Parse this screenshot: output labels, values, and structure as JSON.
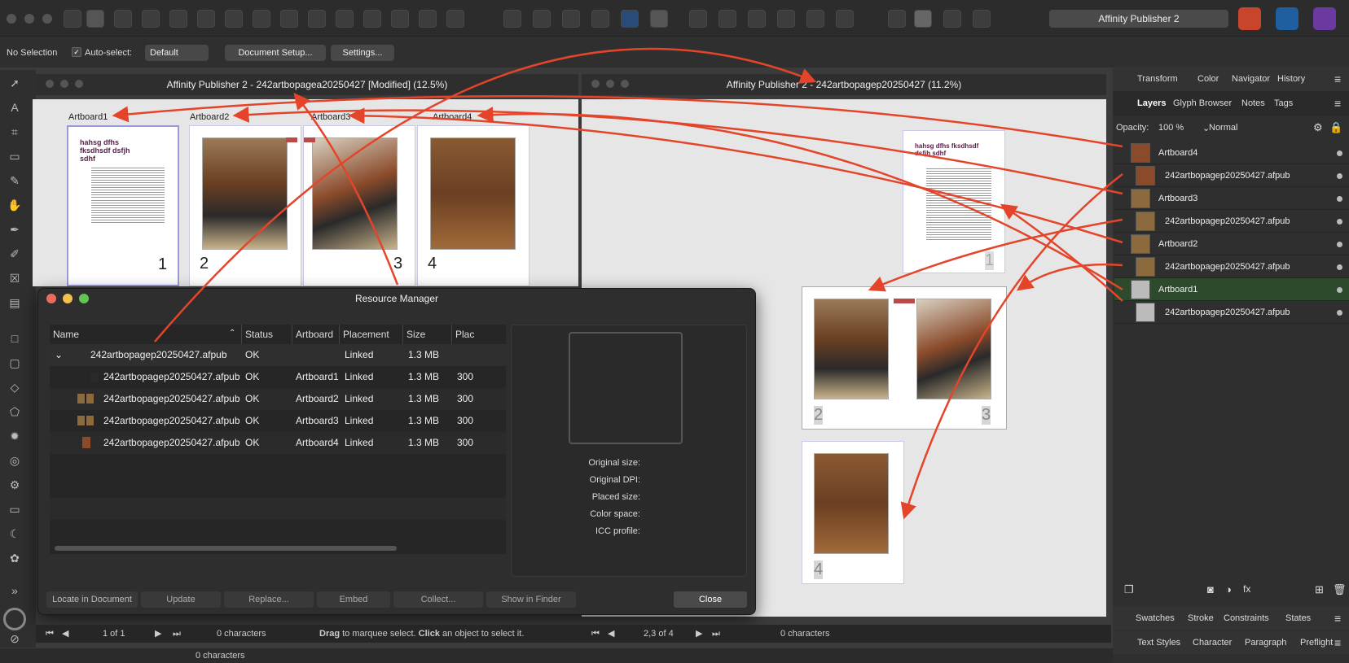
{
  "app": {
    "name": "Affinity Publisher 2"
  },
  "context": {
    "selection": "No Selection",
    "autoselect_label": "Auto-select:",
    "autoselect_value": "Default",
    "doc_setup": "Document Setup...",
    "settings": "Settings..."
  },
  "windows": {
    "left_title": "Affinity Publisher 2 - 242artbopagea20250427 [Modified] (12.5%)",
    "right_title": "Affinity Publisher 2 - 242artbopagep20250427 (11.2%)"
  },
  "artboards": [
    "Artboard1",
    "Artboard2",
    "Artboard3",
    "Artboard4"
  ],
  "page_text": "hahsg dfhs fksdhsdf dsfjh sdhf",
  "page_numbers": [
    "1",
    "2",
    "3",
    "4"
  ],
  "resource_manager": {
    "title": "Resource Manager",
    "columns": [
      "Name",
      "Status",
      "Artboard",
      "Placement",
      "Size",
      "Plac"
    ],
    "rows": [
      {
        "name": "242artbopagep20250427.afpub",
        "status": "OK",
        "artboard": "",
        "placement": "Linked",
        "size": "1.3 MB",
        "plac": ""
      },
      {
        "name": "242artbopagep20250427.afpub",
        "status": "OK",
        "artboard": "Artboard1",
        "placement": "Linked",
        "size": "1.3 MB",
        "plac": "300"
      },
      {
        "name": "242artbopagep20250427.afpub",
        "status": "OK",
        "artboard": "Artboard2",
        "placement": "Linked",
        "size": "1.3 MB",
        "plac": "300"
      },
      {
        "name": "242artbopagep20250427.afpub",
        "status": "OK",
        "artboard": "Artboard3",
        "placement": "Linked",
        "size": "1.3 MB",
        "plac": "300"
      },
      {
        "name": "242artbopagep20250427.afpub",
        "status": "OK",
        "artboard": "Artboard4",
        "placement": "Linked",
        "size": "1.3 MB",
        "plac": "300"
      }
    ],
    "preview_labels": [
      "Original size:",
      "Original DPI:",
      "Placed size:",
      "Color space:",
      "ICC profile:"
    ],
    "buttons": [
      "Locate in Document",
      "Update",
      "Replace...",
      "Embed",
      "Collect...",
      "Show in Finder"
    ],
    "close": "Close"
  },
  "panel": {
    "tabs_top": [
      "Transform",
      "Color",
      "Navigator",
      "History"
    ],
    "tabs_mid": [
      "Layers",
      "Glyph Browser",
      "Notes",
      "Tags"
    ],
    "opacity_label": "Opacity:",
    "opacity_value": "100 %",
    "blend": "Normal",
    "layers": [
      "Artboard4",
      "242artbopagep20250427.afpub",
      "Artboard3",
      "242artbopagep20250427.afpub",
      "Artboard2",
      "242artbopagep20250427.afpub",
      "Artboard1",
      "242artbopagep20250427.afpub"
    ],
    "tabs_b1": [
      "Swatches",
      "Stroke",
      "Constraints",
      "States"
    ],
    "tabs_b2": [
      "Text Styles",
      "Character",
      "Paragraph",
      "Preflight"
    ]
  },
  "status": {
    "left_page": "1 of 1",
    "left_chars": "0 characters",
    "hint_bold1": "Drag",
    "hint_mid": " to marquee select. ",
    "hint_bold2": "Click",
    "hint_end": " an object to select it.",
    "right_page": "2,3 of 4",
    "right_chars": "0 characters",
    "bottom_chars": "0 characters"
  }
}
